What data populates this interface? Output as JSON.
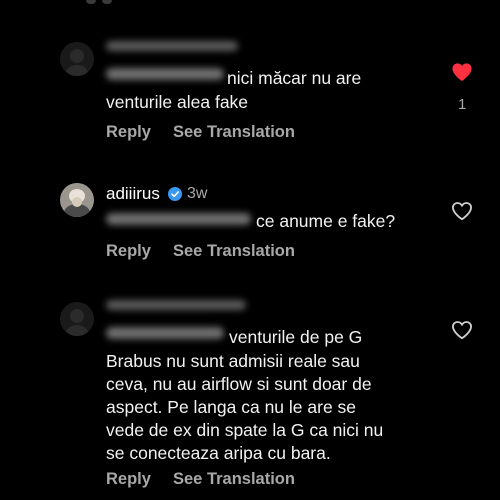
{
  "colors": {
    "background": "#000000",
    "text": "#f2f2f2",
    "secondary": "#a8a8a8",
    "liked_heart": "#ff3040",
    "verified": "#3897f0"
  },
  "comments": [
    {
      "avatar": "blurred-avatar",
      "text_lines": [
        "nici măcar nu are",
        "venturile alea fake"
      ],
      "reply_label": "Reply",
      "translate_label": "See Translation",
      "liked": true,
      "like_count": "1"
    },
    {
      "avatar": "profile-photo-avatar",
      "username": "adiiirus",
      "verified": true,
      "time": "3w",
      "text_lines": [
        "ce anume e fake?"
      ],
      "reply_label": "Reply",
      "translate_label": "See Translation",
      "liked": false
    },
    {
      "avatar": "blurred-avatar",
      "text_lines": [
        "venturile de pe G",
        "Brabus nu sunt admisii reale sau",
        "ceva, nu au airflow si sunt doar de",
        "aspect. Pe langa ca nu le are se",
        "vede de ex din spate la G ca nici nu",
        "se conecteaza aripa cu bara."
      ],
      "reply_label": "Reply",
      "translate_label": "See Translation",
      "liked": false
    }
  ]
}
